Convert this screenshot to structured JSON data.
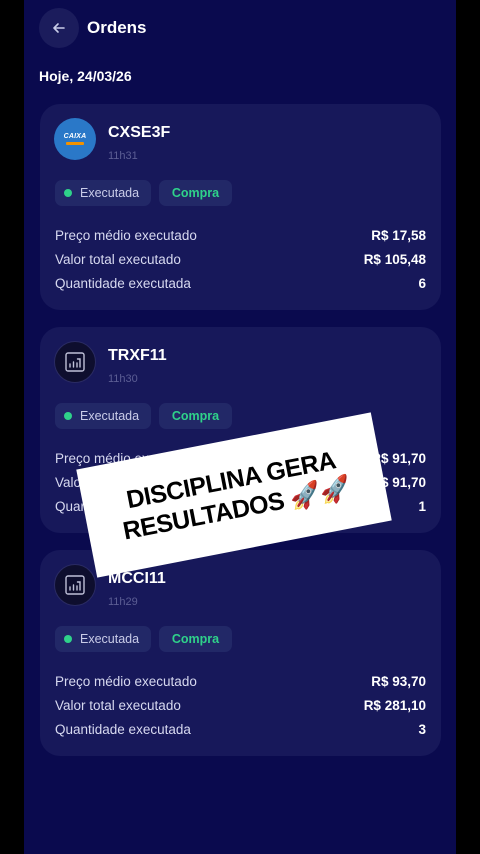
{
  "header": {
    "title": "Ordens"
  },
  "date_label": "Hoje, 24/03/26",
  "orders": [
    {
      "ticker": "CXSE3F",
      "time": "11h31",
      "logo": {
        "type": "caixa",
        "text": "CAIXA"
      },
      "status": "Executada",
      "side": "Compra",
      "rows": [
        {
          "label": "Preço médio executado",
          "value": "R$ 17,58"
        },
        {
          "label": "Valor total executado",
          "value": "R$ 105,48"
        },
        {
          "label": "Quantidade executada",
          "value": "6"
        }
      ]
    },
    {
      "ticker": "TRXF11",
      "time": "11h30",
      "logo": {
        "type": "fund-chart-icon"
      },
      "status": "Executada",
      "side": "Compra",
      "rows": [
        {
          "label": "Preço médio executado",
          "value": "R$ 91,70"
        },
        {
          "label": "Valor total executado",
          "value": "R$ 91,70"
        },
        {
          "label": "Quantidade executada",
          "value": "1"
        }
      ]
    },
    {
      "ticker": "MCCI11",
      "time": "11h29",
      "logo": {
        "type": "fund-chart-icon"
      },
      "status": "Executada",
      "side": "Compra",
      "rows": [
        {
          "label": "Preço médio executado",
          "value": "R$ 93,70"
        },
        {
          "label": "Valor total executado",
          "value": "R$ 281,10"
        },
        {
          "label": "Quantidade executada",
          "value": "3"
        }
      ]
    }
  ],
  "overlay": {
    "line1": "DISCIPLINA GERA",
    "line2": "RESULTADOS 🚀🚀"
  },
  "colors": {
    "background": "#0a0a4e",
    "card": "#17185a",
    "status_green": "#2fd28a",
    "caixa_blue": "#2a78c8"
  }
}
